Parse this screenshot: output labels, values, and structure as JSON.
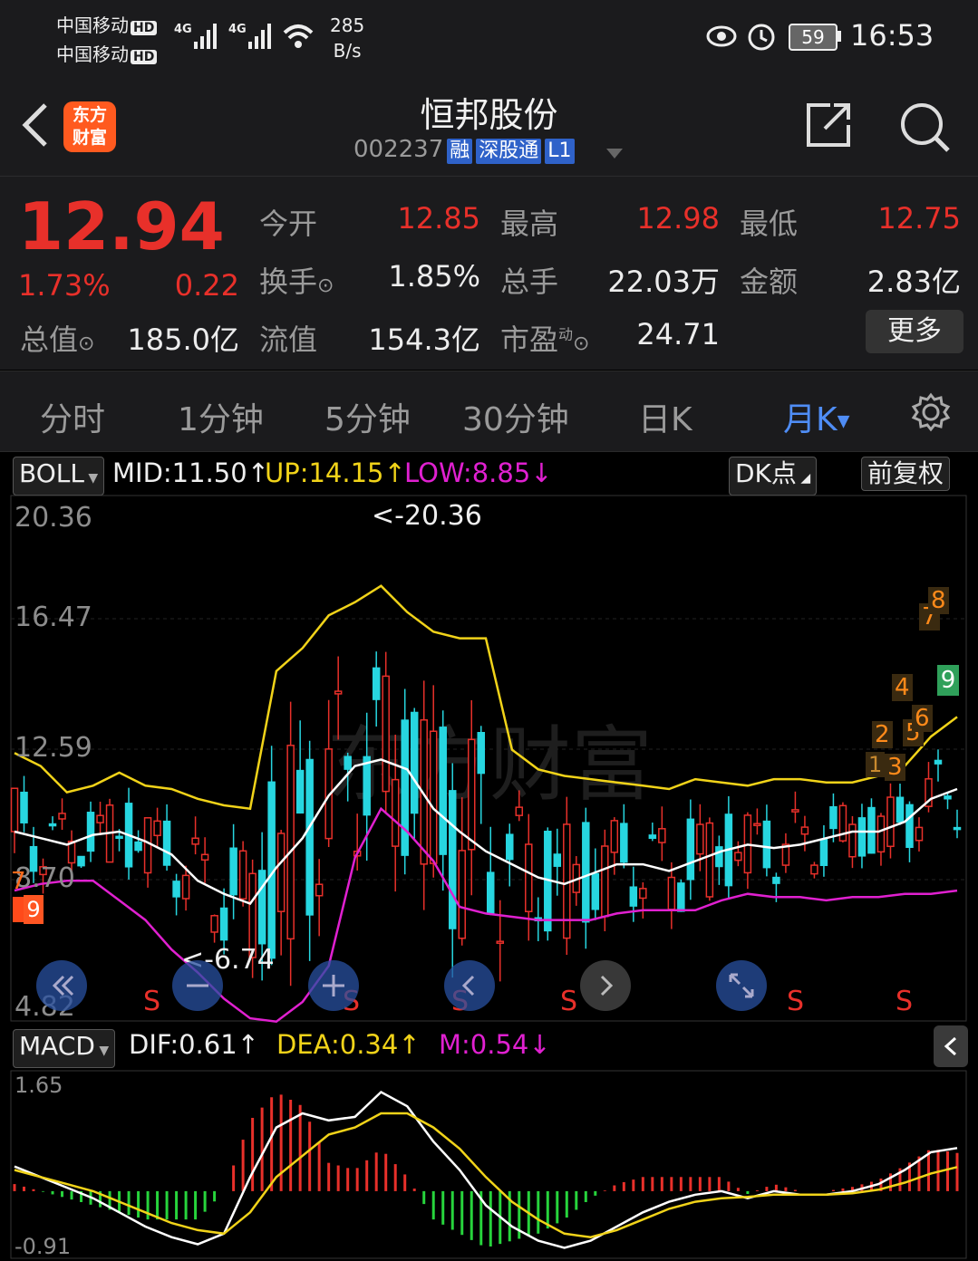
{
  "status_bar": {
    "carrier1": "中国移动",
    "carrier2": "中国移动",
    "hd": "HD",
    "net1": "4G",
    "net2": "4G",
    "speed_value": "285",
    "speed_unit": "B/s",
    "battery": "59",
    "time": "16:53"
  },
  "header": {
    "logo_line1": "东方",
    "logo_line2": "财富",
    "title": "恒邦股份",
    "code": "002237",
    "tags": [
      "融",
      "深股通",
      "L1"
    ]
  },
  "quote": {
    "price": "12.94",
    "change_pct": "1.73%",
    "change": "0.22",
    "open_label": "今开",
    "open": "12.85",
    "high_label": "最高",
    "high": "12.98",
    "low_label": "最低",
    "low": "12.75",
    "turnover_label": "换手",
    "turnover": "1.85%",
    "volume_label": "总手",
    "volume": "22.03万",
    "amount_label": "金额",
    "amount": "2.83亿",
    "mktcap_label": "总值",
    "mktcap": "185.0亿",
    "float_label": "流值",
    "float_cap": "154.3亿",
    "pe_label": "市盈",
    "pe_sup": "动",
    "pe": "24.71",
    "more": "更多"
  },
  "tabs": [
    "分时",
    "1分钟",
    "5分钟",
    "30分钟",
    "日K",
    "月K"
  ],
  "active_tab": "月K",
  "boll": {
    "name": "BOLL",
    "mid": "MID:11.50",
    "up": "UP:14.15",
    "low": "LOW:8.85",
    "dk_button": "DK点",
    "adjust_button": "前复权",
    "axis": [
      "20.36",
      "16.47",
      "12.59",
      "8.70",
      "4.82"
    ],
    "max_label": "<-20.36",
    "min_label": "<-6.74",
    "s_marks": [
      "S",
      "S",
      "S",
      "S",
      "S",
      "S"
    ],
    "nine_counts": [
      "1",
      "2",
      "3",
      "4",
      "5",
      "6",
      "7",
      "8",
      "9"
    ],
    "left_counts": [
      "7",
      "8",
      "9"
    ],
    "watermark": "东方财富"
  },
  "macd": {
    "name": "MACD",
    "dif": "DIF:0.61",
    "dea": "DEA:0.34",
    "m": "M:0.54",
    "axis_top": "1.65",
    "axis_bottom": "-0.91"
  },
  "colors": {
    "up": "#e8302a",
    "down": "#27d6e0",
    "mid": "#ffffff",
    "upper": "#f1d319",
    "lower": "#e020d0",
    "macd_up": "#e8302a",
    "macd_down": "#27d43c"
  },
  "chart_data": [
    {
      "type": "candlestick",
      "title": "BOLL",
      "ylim": [
        4.82,
        20.36
      ],
      "y_ticks": [
        20.36,
        16.47,
        12.59,
        8.7,
        4.82
      ],
      "series": [
        {
          "name": "MID",
          "values": [
            10.6,
            10.4,
            10.2,
            10.5,
            10.6,
            10.3,
            9.9,
            9.1,
            8.7,
            8.4,
            9.5,
            10.4,
            11.7,
            12.6,
            12.8,
            12.5,
            11.3,
            10.6,
            10.0,
            9.6,
            9.2,
            9.0,
            9.3,
            9.6,
            9.6,
            9.4,
            9.7,
            10.0,
            10.2,
            10.1,
            10.2,
            10.4,
            10.6,
            10.6,
            10.9,
            11.6,
            11.9
          ]
        },
        {
          "name": "UP",
          "values": [
            13.0,
            12.6,
            11.8,
            12.0,
            12.4,
            12.0,
            11.9,
            11.6,
            11.4,
            11.3,
            15.5,
            16.2,
            17.2,
            17.6,
            18.1,
            17.3,
            16.7,
            16.5,
            16.5,
            13.1,
            12.5,
            12.3,
            12.2,
            12.1,
            12.0,
            11.9,
            12.2,
            12.1,
            12.0,
            12.2,
            12.2,
            12.1,
            12.1,
            12.3,
            12.6,
            13.5,
            14.1
          ]
        },
        {
          "name": "LOW",
          "values": [
            8.8,
            9.0,
            9.1,
            9.1,
            8.5,
            7.9,
            7.0,
            6.3,
            5.5,
            4.9,
            4.8,
            5.4,
            6.5,
            9.8,
            11.3,
            10.6,
            9.7,
            8.3,
            8.1,
            8.0,
            7.9,
            7.9,
            7.9,
            8.1,
            8.2,
            8.2,
            8.2,
            8.5,
            8.7,
            8.6,
            8.6,
            8.5,
            8.6,
            8.6,
            8.7,
            8.7,
            8.8
          ]
        }
      ],
      "last_close": 12.94,
      "max": 20.36,
      "min": 6.74
    },
    {
      "type": "bar",
      "title": "MACD",
      "ylim": [
        -0.91,
        1.65
      ],
      "series": [
        {
          "name": "DIF",
          "values": [
            0.35,
            0.2,
            0.05,
            -0.1,
            -0.3,
            -0.5,
            -0.65,
            -0.75,
            -0.6,
            0.2,
            0.9,
            1.1,
            1.0,
            1.05,
            1.4,
            1.2,
            0.7,
            0.3,
            -0.2,
            -0.5,
            -0.7,
            -0.8,
            -0.7,
            -0.5,
            -0.3,
            -0.15,
            -0.05,
            0.0,
            -0.1,
            0.0,
            -0.05,
            -0.05,
            0.0,
            0.1,
            0.3,
            0.55,
            0.61
          ]
        },
        {
          "name": "DEA",
          "values": [
            0.3,
            0.2,
            0.1,
            0.0,
            -0.15,
            -0.3,
            -0.45,
            -0.55,
            -0.6,
            -0.3,
            0.2,
            0.5,
            0.8,
            0.9,
            1.1,
            1.1,
            0.9,
            0.6,
            0.2,
            -0.15,
            -0.4,
            -0.6,
            -0.65,
            -0.55,
            -0.4,
            -0.25,
            -0.15,
            -0.1,
            -0.08,
            -0.05,
            -0.05,
            -0.05,
            -0.03,
            0.02,
            0.12,
            0.25,
            0.34
          ]
        }
      ]
    }
  ]
}
